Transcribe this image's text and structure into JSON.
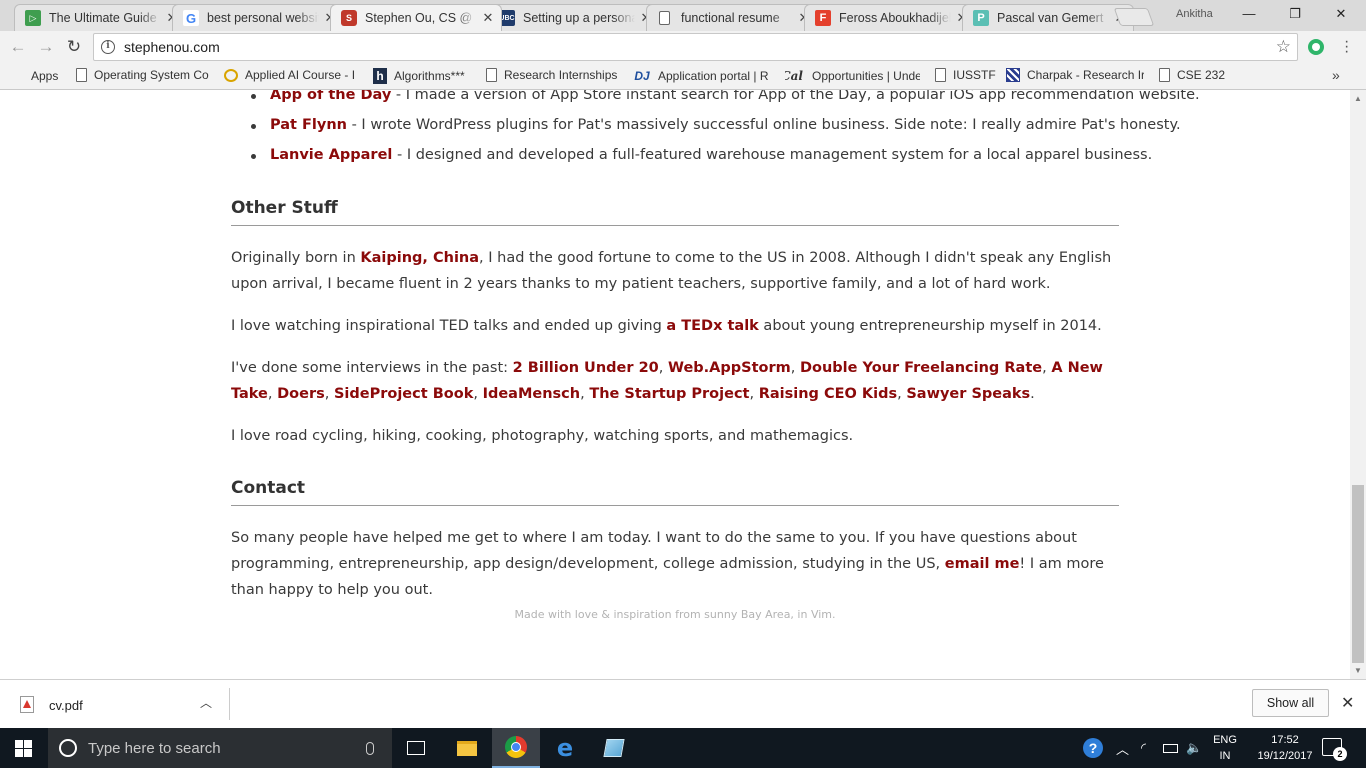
{
  "browser": {
    "tabs": [
      {
        "title": "The Ultimate Guide",
        "favicon_color": "#3f9e4f",
        "favicon_text": "▷"
      },
      {
        "title": "best personal website",
        "favicon_color": "#ffffff",
        "favicon_text": "G"
      },
      {
        "title": "Stephen Ou, CS @",
        "favicon_color": "#c0392b",
        "favicon_text": "S"
      },
      {
        "title": "Setting up a personal",
        "favicon_color": "#1f3b6b",
        "favicon_text": "UBC"
      },
      {
        "title": "functional resume",
        "favicon_color": "#ffffff",
        "favicon_text": ""
      },
      {
        "title": "Feross Aboukhadijeh",
        "favicon_color": "#e4402d",
        "favicon_text": "F"
      },
      {
        "title": "Pascal van Gemert",
        "favicon_color": "#5bbfb4",
        "favicon_text": "P"
      }
    ],
    "profile_name": "Ankitha",
    "url": "stephenou.com",
    "bookmarks": [
      {
        "label": "Apps",
        "icon": "apps-grid-icon"
      },
      {
        "label": "Operating System Co",
        "icon": "page-icon"
      },
      {
        "label": "Applied AI Course - I",
        "icon": "ai-course-icon"
      },
      {
        "label": "Algorithms***",
        "icon": "h-icon"
      },
      {
        "label": "Research Internships",
        "icon": "page-icon"
      },
      {
        "label": "Application portal | R",
        "icon": "dj-icon"
      },
      {
        "label": "Opportunities | Unde",
        "icon": "cal-icon"
      },
      {
        "label": "IUSSTF",
        "icon": "page-icon"
      },
      {
        "label": "Charpak - Research Ir",
        "icon": "charpak-icon"
      },
      {
        "label": "CSE 232",
        "icon": "page-icon"
      }
    ]
  },
  "page": {
    "projects": [
      {
        "name": "App of the Day",
        "desc": " - I made a version of App Store instant search for App of the Day, a popular iOS app recommendation website."
      },
      {
        "name": "Pat Flynn",
        "desc": " - I wrote WordPress plugins for Pat's massively successful online business. Side note: I really admire Pat's honesty."
      },
      {
        "name": "Lanvie Apparel",
        "desc": " - I designed and developed a full-featured warehouse management system for a local apparel business."
      }
    ],
    "other_stuff": {
      "heading": "Other Stuff",
      "p1_pre": "Originally born in ",
      "p1_link": "Kaiping, China",
      "p1_post": ", I had the good fortune to come to the US in 2008. Although I didn't speak any English upon arrival, I became fluent in 2 years thanks to my patient teachers, supportive family, and a lot of hard work.",
      "p2_pre": "I love watching inspirational TED talks and ended up giving ",
      "p2_link": "a TEDx talk",
      "p2_post": " about young entrepreneurship myself in 2014.",
      "p3_pre": "I've done some interviews in the past: ",
      "interviews": [
        "2 Billion Under 20",
        "Web.AppStorm",
        "Double Your Freelancing Rate",
        "A New Take",
        "Doers",
        "SideProject Book",
        "IdeaMensch",
        "The Startup Project",
        "Raising CEO Kids",
        "Sawyer Speaks"
      ],
      "p4": "I love road cycling, hiking, cooking, photography, watching sports, and mathemagics."
    },
    "contact": {
      "heading": "Contact",
      "p_pre": "So many people have helped me get to where I am today. I want to do the same to you. If you have questions about programming, entrepreneurship, app design/development, college admission, studying in the US, ",
      "p_link": "email me",
      "p_post": "! I am more than happy to help you out."
    },
    "footer": "Made with love & inspiration from sunny Bay Area, in Vim.",
    "link_color": "#8b0a0a"
  },
  "downloads": {
    "file_name": "cv.pdf",
    "show_all_label": "Show all"
  },
  "taskbar": {
    "search_placeholder": "Type here to search",
    "lang_line1": "ENG",
    "lang_line2": "IN",
    "time": "17:52",
    "date": "19/12/2017",
    "notification_count": "2"
  }
}
